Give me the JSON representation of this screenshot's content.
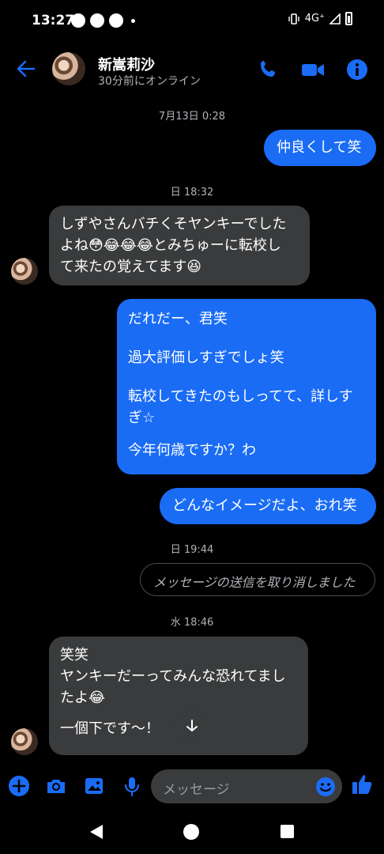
{
  "status_bar": {
    "time": "13:27",
    "network": "4G⁺",
    "app_icons": [
      "messenger-icon",
      "messenger-icon",
      "messenger-icon",
      "messenger-icon"
    ]
  },
  "header": {
    "contact_name": "新嵩莉沙",
    "presence": "30分前にオンライン",
    "accent_color": "#1a6cf5"
  },
  "messages": [
    {
      "type": "timestamp",
      "text": "7月13日 0:28"
    },
    {
      "type": "sent",
      "text": "仲良くして笑"
    },
    {
      "type": "timestamp",
      "text": "日 18:32"
    },
    {
      "type": "received",
      "lines": [
        "しずやさんバチくそヤンキーでした",
        "よね😳😂😂😂とみちゅーに転校し",
        "て来たの覚えてます😆"
      ]
    },
    {
      "type": "sent",
      "paragraphs": [
        "だれだー、君笑",
        "過大評価しすぎでしょ笑",
        "転校してきたのもしってて、詳しす",
        "ぎ☆",
        "今年何歳ですか？わ"
      ]
    },
    {
      "type": "sent",
      "text": "どんなイメージだよ、おれ笑"
    },
    {
      "type": "timestamp",
      "text": "日 19:44"
    },
    {
      "type": "unsent",
      "text": "メッセージの送信を取り消しました"
    },
    {
      "type": "timestamp",
      "text": "水 18:46"
    },
    {
      "type": "received",
      "lines": [
        "笑笑",
        "ヤンキーだーってみんな恐れてまし",
        "たよ😂",
        "",
        "一個下です〜！"
      ]
    }
  ],
  "composer": {
    "placeholder": "メッセージ"
  }
}
